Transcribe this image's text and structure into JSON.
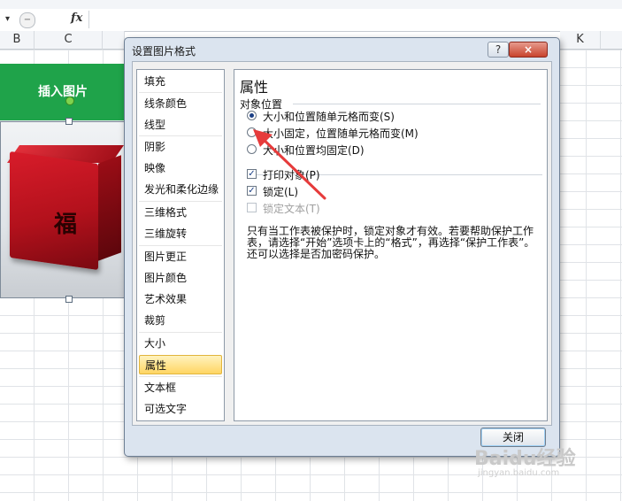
{
  "excel": {
    "fx_label": "fx",
    "columns": [
      "B",
      "C",
      "K"
    ],
    "banner_text": "插入图片"
  },
  "dialog": {
    "title": "设置图片格式",
    "help_label": "?",
    "close_icon": "×",
    "nav_items": [
      {
        "label": "填充"
      },
      {
        "label": "线条颜色"
      },
      {
        "label": "线型"
      },
      {
        "label": "阴影"
      },
      {
        "label": "映像"
      },
      {
        "label": "发光和柔化边缘"
      },
      {
        "label": "三维格式"
      },
      {
        "label": "三维旋转"
      },
      {
        "label": "图片更正"
      },
      {
        "label": "图片颜色"
      },
      {
        "label": "艺术效果"
      },
      {
        "label": "裁剪"
      },
      {
        "label": "大小"
      },
      {
        "label": "属性"
      },
      {
        "label": "文本框"
      },
      {
        "label": "可选文字"
      }
    ],
    "selected_nav": "属性",
    "panel": {
      "title": "属性",
      "position_group": "对象位置",
      "radios": [
        {
          "label": "大小和位置随单元格而变(S)",
          "selected": true
        },
        {
          "label": "大小固定，位置随单元格而变(M)",
          "selected": false
        },
        {
          "label": "大小和位置均固定(D)",
          "selected": false
        }
      ],
      "checks": [
        {
          "label": "打印对象(P)",
          "checked": true
        },
        {
          "label": "锁定(L)",
          "checked": true
        },
        {
          "label": "锁定文本(T)",
          "checked": false
        }
      ],
      "info_text": "只有当工作表被保护时，锁定对象才有效。若要帮助保护工作表，请选择“开始”选项卡上的“格式”，再选择“保护工作表”。还可以选择是否加密码保护。"
    },
    "close_button": "关闭"
  },
  "annotation": {
    "arrow_color": "#e63b3b"
  },
  "watermark": {
    "text": "Baidu经验",
    "sub": "jingyan.baidu.com"
  },
  "colors": {
    "banner": "#1fa34a",
    "selected_nav": "#ffd563"
  }
}
